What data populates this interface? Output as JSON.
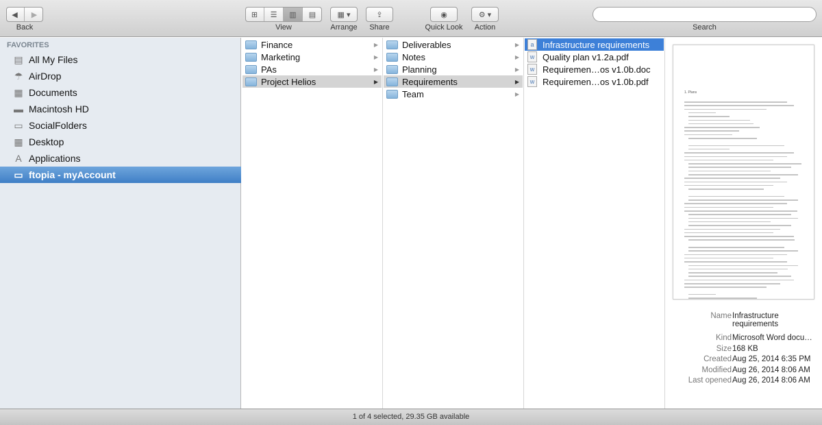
{
  "toolbar": {
    "back": "Back",
    "view": "View",
    "arrange": "Arrange",
    "share": "Share",
    "quick_look": "Quick Look",
    "action": "Action",
    "search": "Search",
    "search_value": ""
  },
  "sidebar": {
    "heading": "FAVORITES",
    "items": [
      {
        "label": "All My Files",
        "icon": "all-files-icon",
        "glyph": "▤"
      },
      {
        "label": "AirDrop",
        "icon": "airdrop-icon",
        "glyph": "☂"
      },
      {
        "label": "Documents",
        "icon": "documents-icon",
        "glyph": "▦"
      },
      {
        "label": "Macintosh HD",
        "icon": "hard-drive-icon",
        "glyph": "▬"
      },
      {
        "label": "SocialFolders",
        "icon": "folder-icon",
        "glyph": "▭"
      },
      {
        "label": "Desktop",
        "icon": "desktop-icon",
        "glyph": "▦"
      },
      {
        "label": "Applications",
        "icon": "applications-icon",
        "glyph": "A"
      },
      {
        "label": "ftopia - myAccount",
        "icon": "folder-icon",
        "glyph": "▭",
        "selected": true
      }
    ]
  },
  "columns": [
    {
      "items": [
        "Finance",
        "Marketing",
        "PAs",
        "Project Helios"
      ],
      "selected": 3
    },
    {
      "items": [
        "Deliverables",
        "Notes",
        "Planning",
        "Requirements",
        "Team"
      ],
      "selected": 3
    },
    {
      "items": [
        "Infrastructure requirements",
        "Quality plan v1.2a.pdf",
        "Requiremen…os v1.0b.doc",
        "Requiremen…os v1.0b.pdf"
      ],
      "selected": 0
    }
  ],
  "preview": {
    "heading": "1. Plans",
    "meta": [
      {
        "k": "Name",
        "v": "Infrastructure requirements"
      },
      {
        "k": "Kind",
        "v": "Microsoft Word docu…"
      },
      {
        "k": "Size",
        "v": "168 KB"
      },
      {
        "k": "Created",
        "v": "Aug 25, 2014 6:35 PM"
      },
      {
        "k": "Modified",
        "v": "Aug 26, 2014 8:06 AM"
      },
      {
        "k": "Last opened",
        "v": "Aug 26, 2014 8:06 AM"
      }
    ]
  },
  "status": "1 of 4 selected, 29.35 GB available",
  "colors": {
    "selection": "#3d80d8",
    "sidebar_bg": "#e6ebf1"
  }
}
